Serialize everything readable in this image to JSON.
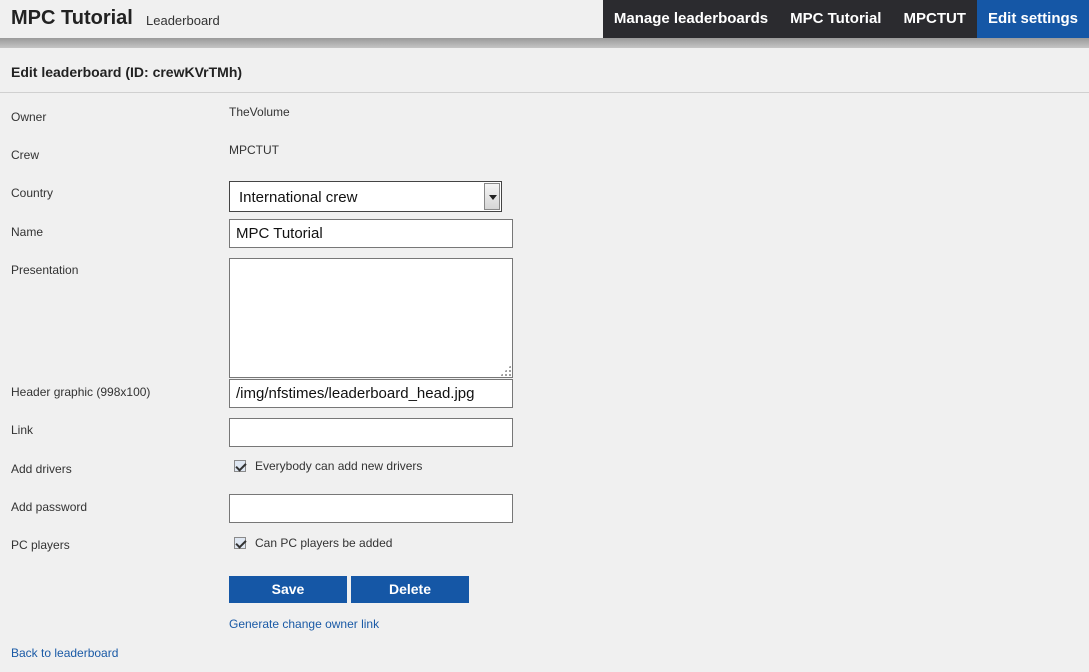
{
  "header": {
    "title": "MPC Tutorial",
    "subtitle": "Leaderboard",
    "nav": [
      {
        "label": "Manage leaderboards"
      },
      {
        "label": "MPC Tutorial"
      },
      {
        "label": "MPCTUT"
      },
      {
        "label": "Edit settings",
        "active": true
      }
    ]
  },
  "form": {
    "title": "Edit leaderboard (ID: crewKVrTMh)",
    "owner": {
      "label": "Owner",
      "value": "TheVolume"
    },
    "crew": {
      "label": "Crew",
      "value": "MPCTUT"
    },
    "country": {
      "label": "Country",
      "selected": "International crew"
    },
    "name": {
      "label": "Name",
      "value": "MPC Tutorial"
    },
    "presentation": {
      "label": "Presentation",
      "value": ""
    },
    "header_graphic": {
      "label": "Header graphic (998x100)",
      "value": "/img/nfstimes/leaderboard_head.jpg"
    },
    "link": {
      "label": "Link",
      "value": ""
    },
    "add_drivers": {
      "label": "Add drivers",
      "checkbox_label": "Everybody can add new drivers",
      "checked": true
    },
    "add_password": {
      "label": "Add password",
      "value": ""
    },
    "pc_players": {
      "label": "PC players",
      "checkbox_label": "Can PC players be added",
      "checked": true
    },
    "save_label": "Save",
    "delete_label": "Delete",
    "change_owner_link": "Generate change owner link"
  },
  "footer": {
    "back_link": "Back to leaderboard"
  },
  "colors": {
    "nav_dark": "#2b2b2f",
    "accent": "#1557a6",
    "link": "#1a5aa6",
    "background": "#f0f0f0"
  }
}
